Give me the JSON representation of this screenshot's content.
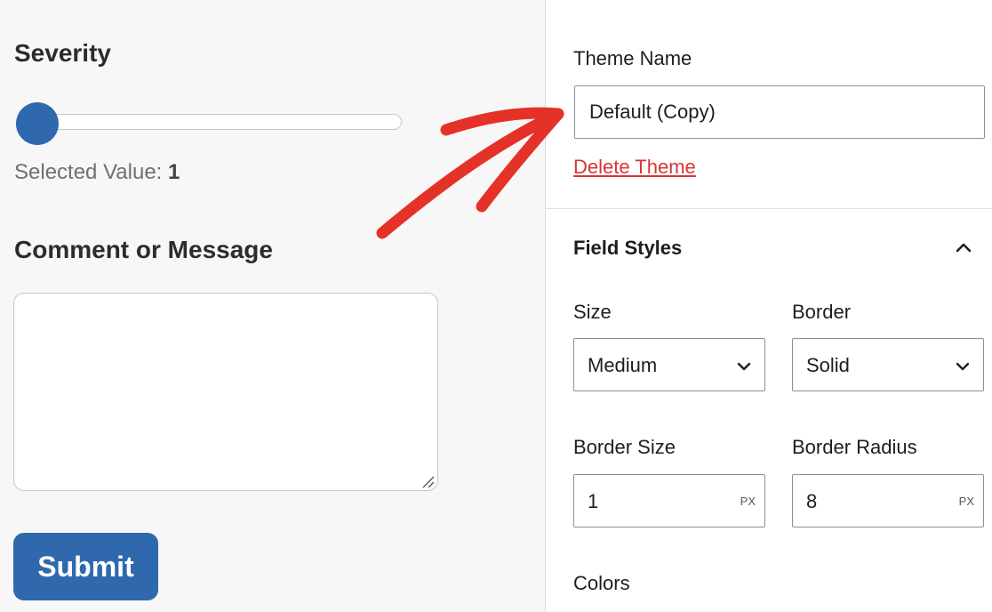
{
  "form_preview": {
    "severity_label": "Severity",
    "slider": {
      "min": 1,
      "max": 10,
      "value": 1,
      "accent_color": "#2f68ad"
    },
    "selected_value_label": "Selected Value: ",
    "selected_value": "1",
    "comment_label": "Comment or Message",
    "comment_value": "",
    "submit_label": "Submit",
    "annotation_arrow_color": "#e53228"
  },
  "settings_panel": {
    "theme_name_label": "Theme Name",
    "theme_name_value": "Default (Copy)",
    "delete_theme_label": "Delete Theme",
    "field_styles": {
      "title": "Field Styles",
      "expanded": true,
      "size": {
        "label": "Size",
        "value": "Medium"
      },
      "border": {
        "label": "Border",
        "value": "Solid"
      },
      "border_size": {
        "label": "Border Size",
        "value": "1",
        "unit": "PX"
      },
      "border_radius": {
        "label": "Border Radius",
        "value": "8",
        "unit": "PX"
      }
    },
    "colors_label": "Colors"
  },
  "icons": {
    "collapse": "chevron-up-icon",
    "dropdown": "chevron-down-icon",
    "textarea_resize": "resize-grip-icon",
    "annotation": "arrow-annotation"
  }
}
